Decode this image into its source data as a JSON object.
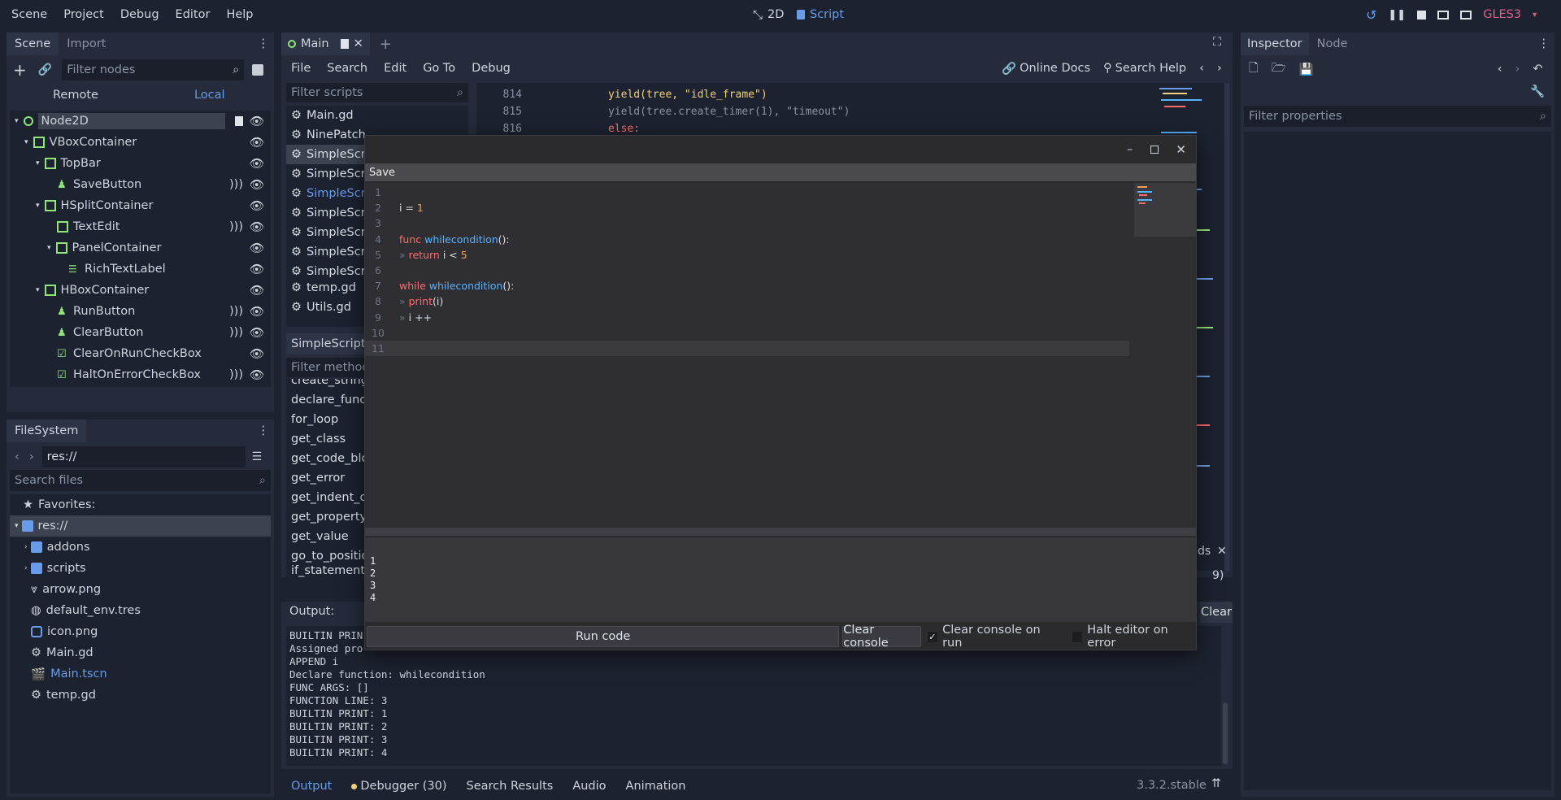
{
  "menu": [
    "Scene",
    "Project",
    "Debug",
    "Editor",
    "Help"
  ],
  "workspaces": {
    "twod": "2D",
    "script": "Script"
  },
  "renderer": "GLES3",
  "scene_dock": {
    "tabs": [
      "Scene",
      "Import"
    ],
    "filter_placeholder": "Filter nodes",
    "remote": "Remote",
    "local": "Local",
    "nodes": [
      "Node2D",
      "VBoxContainer",
      "TopBar",
      "SaveButton",
      "HSplitContainer",
      "TextEdit",
      "PanelContainer",
      "RichTextLabel",
      "HBoxContainer",
      "RunButton",
      "ClearButton",
      "ClearOnRunCheckBox",
      "HaltOnErrorCheckBox"
    ]
  },
  "filesystem": {
    "title": "FileSystem",
    "path": "res://",
    "search_placeholder": "Search files",
    "favorites": "Favorites:",
    "items": [
      "res://",
      "addons",
      "scripts",
      "arrow.png",
      "default_env.tres",
      "icon.png",
      "Main.gd",
      "Main.tscn",
      "temp.gd"
    ]
  },
  "editor_tabs": {
    "main": "Main"
  },
  "script_menu": [
    "File",
    "Search",
    "Edit",
    "Go To",
    "Debug"
  ],
  "online_docs": "Online Docs",
  "search_help": "Search Help",
  "script_list": {
    "filter_placeholder": "Filter scripts",
    "items": [
      "Main.gd",
      "NinePatch",
      "SimpleScri",
      "SimpleScri",
      "SimpleScri",
      "SimpleScri",
      "SimpleScri",
      "SimpleScri",
      "SimpleScri",
      "temp.gd",
      "Utils.gd"
    ],
    "current": "SimpleScript.",
    "methods_placeholder": "Filter method",
    "methods": [
      "create_string",
      "declare_funct",
      "for_loop",
      "get_class",
      "get_code_bloc",
      "get_error",
      "get_indent_of",
      "get_property",
      "get_value",
      "go_to_position",
      "if_statement"
    ]
  },
  "bg_code": {
    "lines": [
      {
        "num": "814",
        "text": "yield(tree, \"idle_frame\")"
      },
      {
        "num": "815",
        "text": "yield(tree.create_timer(1), \"timeout\")"
      },
      {
        "num": "816",
        "text": "else:"
      }
    ]
  },
  "dialog": {
    "save": "Save",
    "lines": [
      {
        "num": "1",
        "tokens": []
      },
      {
        "num": "2",
        "tokens": [
          {
            "t": "i = ",
            "c": "#d8dce4"
          },
          {
            "t": "1",
            "c": "#f0a05a"
          }
        ]
      },
      {
        "num": "3",
        "tokens": []
      },
      {
        "num": "4",
        "tokens": [
          {
            "t": "func ",
            "c": "#ff6b6b"
          },
          {
            "t": "whilecondition",
            "c": "#57b3ff"
          },
          {
            "t": "():",
            "c": "#d8dce4"
          }
        ]
      },
      {
        "num": "5",
        "tokens": [
          {
            "t": "» ",
            "c": "#6d7484"
          },
          {
            "t": "return ",
            "c": "#ff6b6b"
          },
          {
            "t": "i < ",
            "c": "#d8dce4"
          },
          {
            "t": "5",
            "c": "#f0a05a"
          }
        ]
      },
      {
        "num": "6",
        "tokens": []
      },
      {
        "num": "7",
        "tokens": [
          {
            "t": "while ",
            "c": "#ff6b6b"
          },
          {
            "t": "whilecondition",
            "c": "#57b3ff"
          },
          {
            "t": "():",
            "c": "#d8dce4"
          }
        ]
      },
      {
        "num": "8",
        "tokens": [
          {
            "t": "» ",
            "c": "#6d7484"
          },
          {
            "t": "print",
            "c": "#ff6b6b"
          },
          {
            "t": "(i)",
            "c": "#d8dce4"
          }
        ]
      },
      {
        "num": "9",
        "tokens": [
          {
            "t": "» ",
            "c": "#6d7484"
          },
          {
            "t": "i ++",
            "c": "#d8dce4"
          }
        ]
      },
      {
        "num": "10",
        "tokens": []
      },
      {
        "num": "11",
        "tokens": []
      }
    ],
    "console": [
      "1",
      "2",
      "3",
      "4"
    ],
    "run_code": "Run code",
    "clear_console": "Clear console",
    "clear_on_run": "Clear console on run",
    "halt_on_error": "Halt editor on error",
    "clear_on_run_checked": true,
    "halt_on_error_checked": false
  },
  "behind_dialog": {
    "ds": "ds",
    "nine": "9)",
    "clear": "Clear"
  },
  "output": {
    "title": "Output:",
    "lines": [
      "BUILTIN PRIN",
      "Assigned pro",
      "APPEND i",
      "Declare function: whilecondition",
      "FUNC ARGS: []",
      "FUNCTION LINE: 3",
      "BUILTIN PRINT: 1",
      "BUILTIN PRINT: 2",
      "BUILTIN PRINT: 3",
      "BUILTIN PRINT: 4"
    ]
  },
  "bottom_tabs": [
    "Output",
    "Debugger (30)",
    "Search Results",
    "Audio",
    "Animation"
  ],
  "version": "3.3.2.stable",
  "inspector": {
    "tabs": [
      "Inspector",
      "Node"
    ],
    "filter_placeholder": "Filter properties"
  },
  "colors": {
    "accent": "#699ce8",
    "selected": "#3c4250",
    "bg": "#1d2230",
    "panel": "#252b3b",
    "renderer": "#e45e8c"
  }
}
